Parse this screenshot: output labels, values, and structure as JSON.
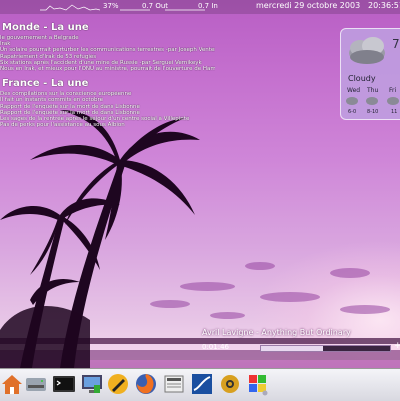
{
  "topbar": {
    "cpu": "37%",
    "net_out": "0.7 Out",
    "net_in": "0.7 In",
    "date": "mercredi 29 octobre 2003",
    "time": "20:36:51"
  },
  "news": {
    "world_title": "Monde - La une",
    "world_items": [
      "le gouvernement a Belgrade",
      "Irak",
      "Un solaire pourrait perturber les communications terrestres -par Joseph Venten-",
      "Rapatriement d'Irak de 53 réfugiés",
      "Six stations après l'accident d'une mine de Russie -par Serguei Vernikeyk",
      "Nous en Irak, et mieux pour l'ONU au ministre, pourrait de l'ouverture de Hambor"
    ],
    "france_title": "France - La une",
    "france_items": [
      "Des compilations sur la conscience européenne",
      "Il fait un instants commits en octobre",
      "Rapport de l'enquête sur la mort de dans Lisbonne",
      "Rapport de l'enquête sur la mort de dans Lisbonne",
      "Les sages de la rentrée après le séjour d'un centre social à Villepinte",
      "Pas de perks pour l'assistance au sous Albion"
    ]
  },
  "weather": {
    "temperature": "7",
    "condition": "Cloudy",
    "days": [
      "Wed",
      "Thu",
      "Fri"
    ],
    "ranges": [
      "6-0",
      "8-10",
      "11"
    ]
  },
  "player": {
    "track": "Avril Lavigne - Anything But Ordinary",
    "elapsed": "0:01:46",
    "progress": 0.48,
    "plus_label": "+"
  },
  "taskbar": {
    "icons": [
      "home-icon",
      "drive-icon",
      "terminal-icon",
      "monitor-icon",
      "pen-icon",
      "firefox-icon",
      "news-icon",
      "wave-icon",
      "settings-gear-icon",
      "flag-icon"
    ]
  }
}
